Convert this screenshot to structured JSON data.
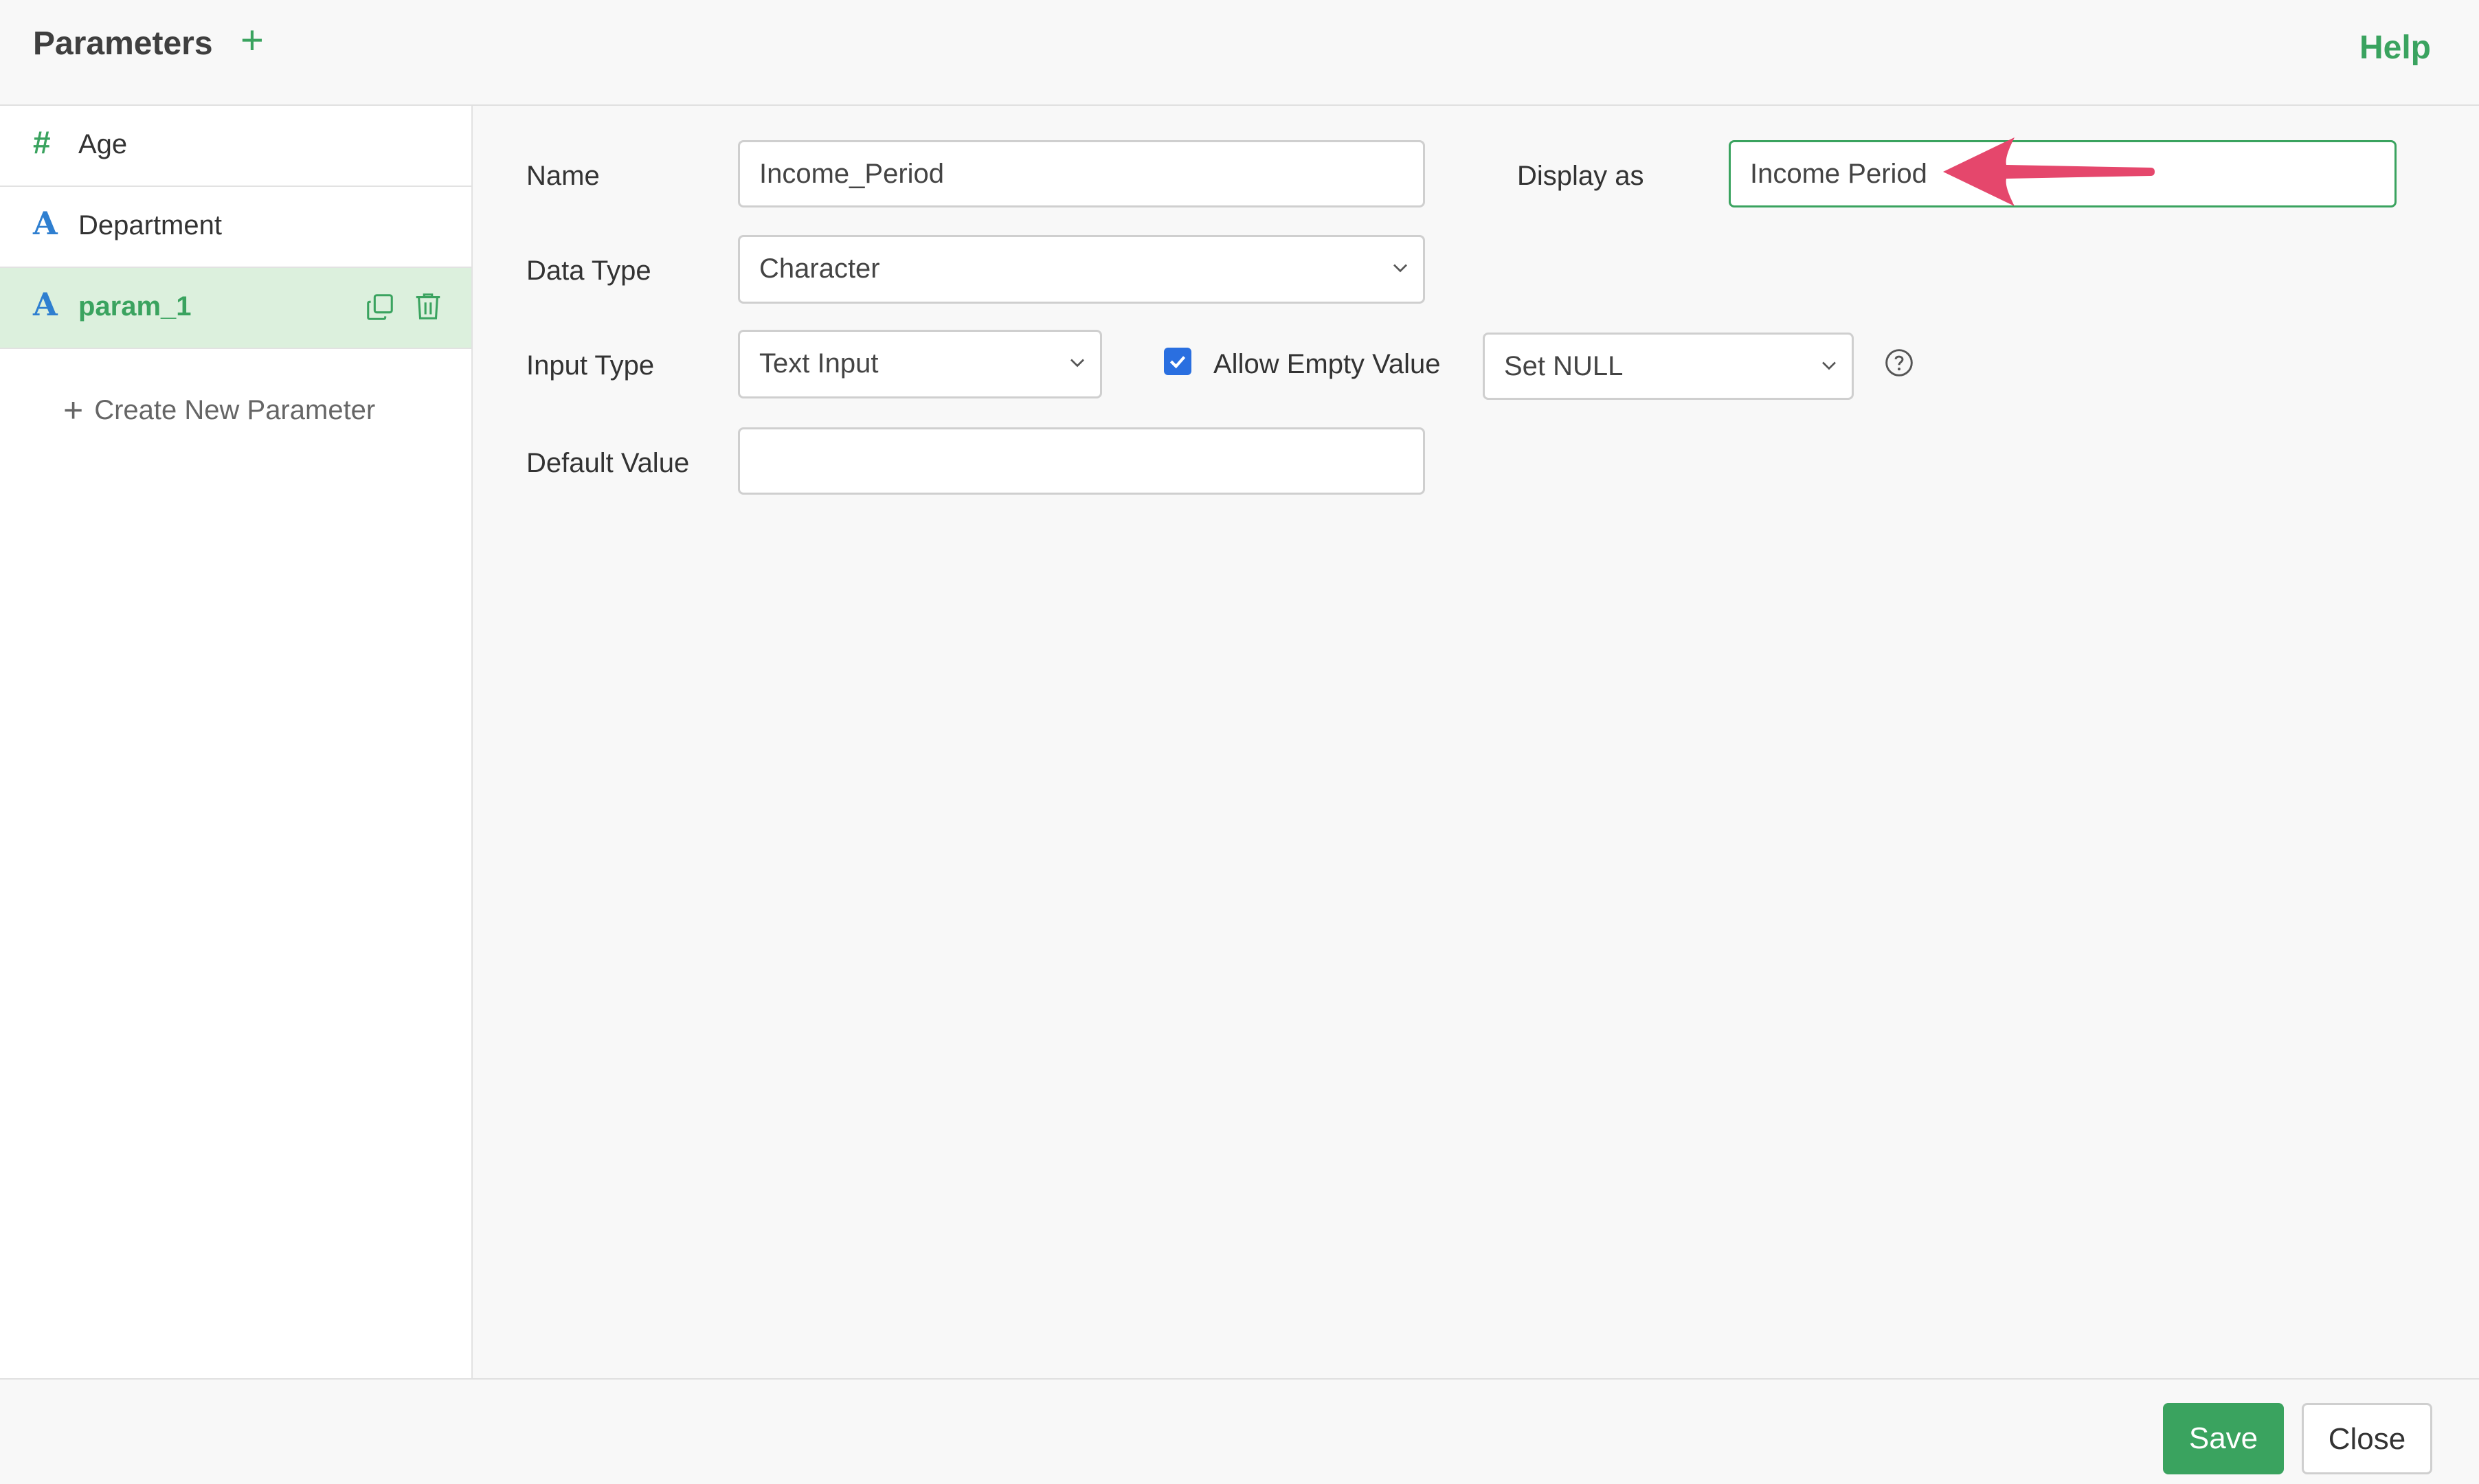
{
  "header": {
    "title": "Parameters",
    "add_icon": "plus-icon",
    "help_label": "Help"
  },
  "sidebar": {
    "items": [
      {
        "icon_text": "#",
        "icon": "number-type-icon",
        "label": "Age"
      },
      {
        "icon_text": "A",
        "icon": "character-type-icon",
        "label": "Department"
      },
      {
        "icon_text": "A",
        "icon": "character-type-icon",
        "label": "param_1",
        "active": true
      }
    ],
    "create_new_label": "Create New Parameter"
  },
  "form": {
    "name_label": "Name",
    "name_value": "Income_Period",
    "display_as_label": "Display as",
    "display_as_value": "Income Period",
    "data_type_label": "Data Type",
    "data_type_value": "Character",
    "input_type_label": "Input Type",
    "input_type_value": "Text Input",
    "allow_empty_label": "Allow Empty Value",
    "allow_empty_checked": true,
    "empty_behavior_value": "Set NULL",
    "default_value_label": "Default Value",
    "default_value": ""
  },
  "footer": {
    "save_label": "Save",
    "close_label": "Close"
  },
  "colors": {
    "accent": "#3aa35f",
    "annotation_arrow": "#e5476c",
    "checkbox": "#2a6fe0",
    "type_icon_blue": "#2f7fd0"
  }
}
